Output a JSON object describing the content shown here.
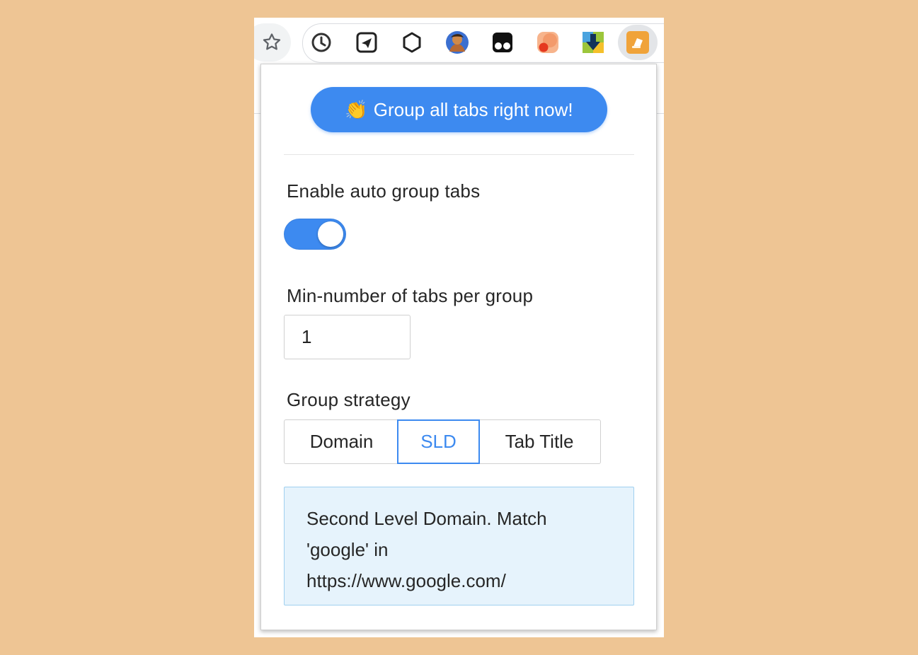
{
  "toolbar": {
    "icons": [
      {
        "name": "bookmark-star-icon"
      },
      {
        "name": "clock-history-icon"
      },
      {
        "name": "send-plane-icon"
      },
      {
        "name": "hexagon-cube-icon"
      },
      {
        "name": "avatar-profile-icon"
      },
      {
        "name": "tampermonkey-icon"
      },
      {
        "name": "orange-dot-icon"
      },
      {
        "name": "download-arrow-icon"
      },
      {
        "name": "tab-group-extension-icon"
      }
    ],
    "colors": {
      "pill_border": "#dadce0",
      "active_bg": "#e3e5e8"
    }
  },
  "popup": {
    "group_button_emoji": "👏",
    "group_button_label": "Group all tabs right now!",
    "auto_group_label": "Enable auto group tabs",
    "auto_group_enabled": true,
    "min_tabs_label": "Min-number of tabs per group",
    "min_tabs_value": "1",
    "strategy_label": "Group strategy",
    "strategy_options": [
      "Domain",
      "SLD",
      "Tab Title"
    ],
    "strategy_selected": "SLD",
    "info_lines": [
      "Second Level Domain. Match",
      "'google' in",
      "https://www.google.com/"
    ]
  },
  "colors": {
    "page_background": "#EEC594",
    "accent": "#3d8af0",
    "info_background": "#e6f3fc",
    "info_border": "#9fd0ef"
  }
}
